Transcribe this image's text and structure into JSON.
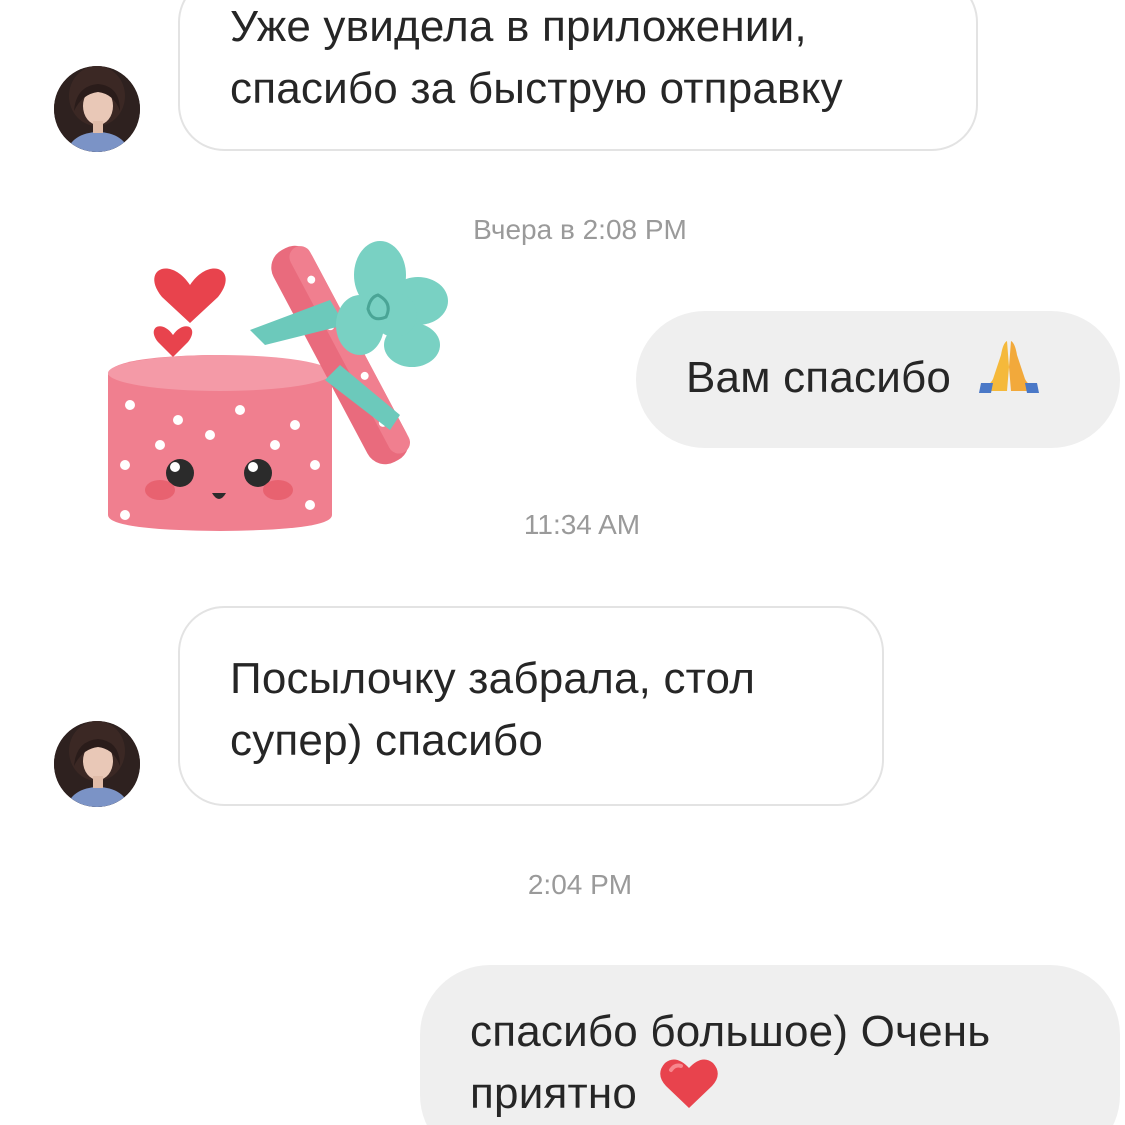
{
  "messages": [
    {
      "id": "m1",
      "direction": "incoming",
      "lines": [
        "Уже увидела в приложении,",
        "спасибо за быструю отправку"
      ]
    },
    {
      "id": "ts1",
      "type": "timestamp",
      "text": "Вчера в 2:08 PM"
    },
    {
      "id": "sticker1",
      "type": "sticker",
      "icon": "gift-box-sticker"
    },
    {
      "id": "m2",
      "direction": "outgoing",
      "text": "Вам спасибо",
      "emoji": "folded-hands-emoji"
    },
    {
      "id": "ts2",
      "type": "timestamp",
      "text": "11:34 AM"
    },
    {
      "id": "m3",
      "direction": "incoming",
      "lines": [
        "Посылочку забрала, стол",
        "супер) спасибо"
      ]
    },
    {
      "id": "ts3",
      "type": "timestamp",
      "text": "2:04 PM"
    },
    {
      "id": "m4",
      "direction": "outgoing",
      "lines": [
        "спасибо большое) Очень",
        "приятно"
      ],
      "emoji": "red-heart-emoji"
    }
  ],
  "colors": {
    "incoming_bubble_bg": "#ffffff",
    "incoming_bubble_border": "#e3e3e3",
    "outgoing_bubble_bg": "#efefef",
    "timestamp": "#9a9a9a",
    "text": "#262626",
    "sticker_pink": "#f07f8f",
    "sticker_ribbon": "#6cc9bb",
    "heart_red": "#e8434d"
  }
}
